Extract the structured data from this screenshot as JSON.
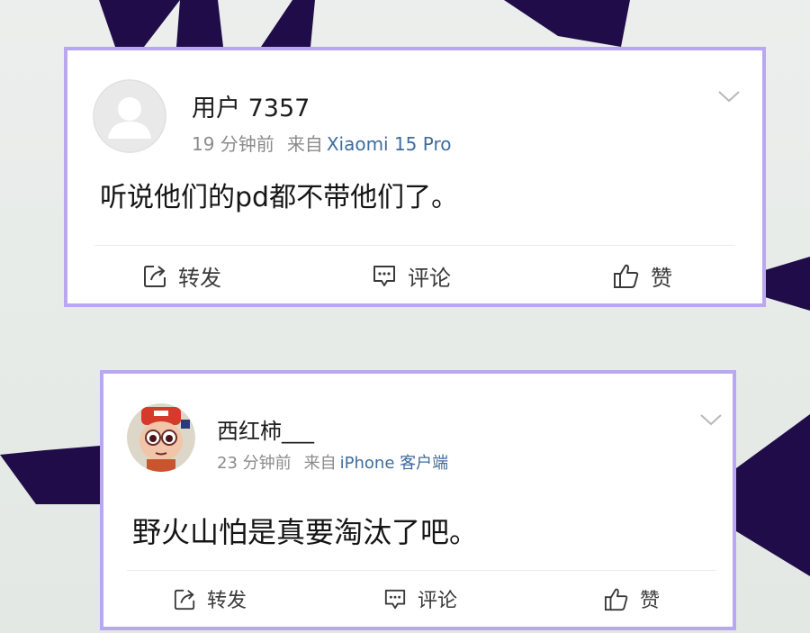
{
  "background": {
    "colors": {
      "base": "#e8ecea",
      "shapes": "#1f0c48",
      "card_border": "#b9a8ef"
    }
  },
  "posts": [
    {
      "username": "用户 7357",
      "time": "19 分钟前",
      "from_label": "来自",
      "source": "Xiaomi 15 Pro",
      "content": "听说他们的pd都不带他们了。",
      "avatar": "default-avatar",
      "actions": {
        "repost": "转发",
        "comment": "评论",
        "like": "赞"
      }
    },
    {
      "username": "西红柿___",
      "time": "23 分钟前",
      "from_label": "来自",
      "source": "iPhone 客户端",
      "content": "野火山怕是真要淘汰了吧。",
      "avatar": "cartoon-avatar",
      "actions": {
        "repost": "转发",
        "comment": "评论",
        "like": "赞"
      }
    }
  ]
}
